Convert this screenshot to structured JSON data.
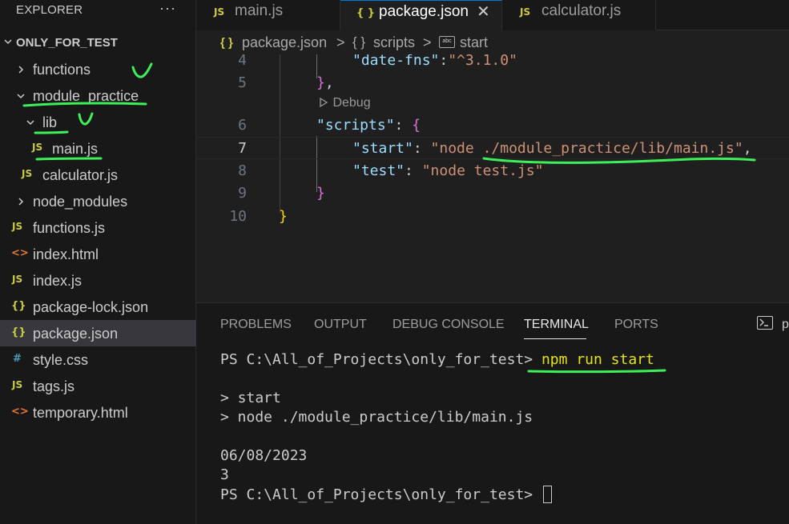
{
  "sidebar": {
    "title": "EXPLORER",
    "more": "···",
    "section": "ONLY_FOR_TEST",
    "items": [
      {
        "label": "functions",
        "icon": "chevron-right-icon"
      },
      {
        "label": "module_practice",
        "icon": "chevron-down-icon"
      },
      {
        "label": "lib",
        "icon": "chevron-down-icon"
      },
      {
        "label": "main.js",
        "icon_text": "JS"
      },
      {
        "label": "calculator.js",
        "icon_text": "JS"
      },
      {
        "label": "node_modules",
        "icon": "chevron-right-icon"
      },
      {
        "label": "functions.js",
        "icon_text": "JS"
      },
      {
        "label": "index.html",
        "icon_text": "<>"
      },
      {
        "label": "index.js",
        "icon_text": "JS"
      },
      {
        "label": "package-lock.json",
        "icon_text": "{}"
      },
      {
        "label": "package.json",
        "icon_text": "{}"
      },
      {
        "label": "style.css",
        "icon_text": "#"
      },
      {
        "label": "tags.js",
        "icon_text": "JS"
      },
      {
        "label": "temporary.html",
        "icon_text": "<>"
      }
    ]
  },
  "tabs": [
    {
      "label": "main.js",
      "icon_text": "JS"
    },
    {
      "label": "package.json",
      "icon_text": "{ }",
      "close": "✕"
    },
    {
      "label": "calculator.js",
      "icon_text": "JS"
    }
  ],
  "breadcrumb": {
    "icon1": "{ }",
    "file": "package.json",
    "sep1": ">",
    "icon2": "{ }",
    "section": "scripts",
    "sep2": ">",
    "icon3": "abc",
    "item": "start"
  },
  "editor": {
    "line_numbers": [
      "4",
      "5",
      "6",
      "7",
      "8",
      "9",
      "10"
    ],
    "codelens": "Debug",
    "lines": {
      "l4": {
        "key": "\"date-fns\"",
        "colon": ":",
        "val": "\"^3.1.0\""
      },
      "l5": {
        "brace": "}",
        "comma": ","
      },
      "l6": {
        "key": "\"scripts\"",
        "colon": ": ",
        "brace": "{"
      },
      "l7": {
        "key": "\"start\"",
        "colon": ": ",
        "val": "\"node ./module_practice/lib/main.js\"",
        "comma": ","
      },
      "l8": {
        "key": "\"test\"",
        "colon": ": ",
        "val": "\"node test.js\""
      },
      "l9": {
        "brace": "}"
      },
      "l10": {
        "brace": "}"
      }
    }
  },
  "panel": {
    "tabs": [
      "PROBLEMS",
      "OUTPUT",
      "DEBUG CONSOLE",
      "TERMINAL",
      "PORTS"
    ],
    "active_tab": "TERMINAL",
    "icon_label": "p",
    "terminal": {
      "prompt": "PS C:\\All_of_Projects\\only_for_test> ",
      "command": "npm run start",
      "out1": "> start",
      "out2": "> node ./module_practice/lib/main.js",
      "out3": "06/08/2023",
      "out4": "3",
      "prompt2": "PS C:\\All_of_Projects\\only_for_test> "
    }
  },
  "colors": {
    "accent": "#0078d4",
    "annotation": "#3df05a",
    "js_icon": "#cbcb41",
    "html_icon": "#e37933",
    "css_icon": "#519aba"
  }
}
